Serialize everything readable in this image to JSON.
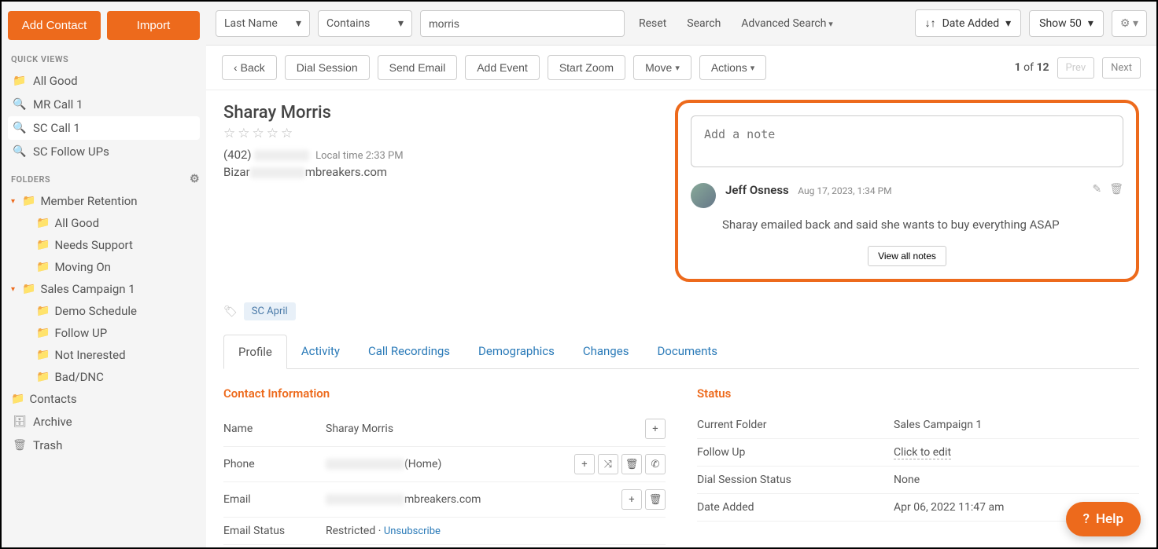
{
  "sidebar": {
    "add_contact": "Add Contact",
    "import": "Import",
    "quick_views_label": "QUICK VIEWS",
    "quick_views": [
      {
        "label": "All Good",
        "type": "folder"
      },
      {
        "label": "MR Call 1",
        "type": "search"
      },
      {
        "label": "SC Call 1",
        "type": "search",
        "active": true
      },
      {
        "label": "SC Follow UPs",
        "type": "search"
      }
    ],
    "folders_label": "FOLDERS",
    "folders": [
      {
        "label": "Member Retention",
        "children": [
          "All Good",
          "Needs Support",
          "Moving On"
        ]
      },
      {
        "label": "Sales Campaign 1",
        "children": [
          "Demo Schedule",
          "Follow UP",
          "Not Inerested",
          "Bad/DNC"
        ]
      }
    ],
    "contacts": "Contacts",
    "archive": "Archive",
    "trash": "Trash"
  },
  "toolbar": {
    "filter_field": "Last Name",
    "filter_op": "Contains",
    "search_value": "morris",
    "reset": "Reset",
    "search": "Search",
    "advanced": "Advanced Search",
    "sort": "Date Added",
    "show": "Show 50"
  },
  "actions": {
    "back": "Back",
    "dial": "Dial Session",
    "email": "Send Email",
    "event": "Add Event",
    "zoom": "Start Zoom",
    "move": "Move",
    "actions": "Actions",
    "page_current": "1",
    "page_sep": "of",
    "page_total": "12",
    "prev": "Prev",
    "next": "Next"
  },
  "contact": {
    "name": "Sharay Morris",
    "phone_prefix": "(402)",
    "local_time": "Local time 2:33 PM",
    "email_prefix": "Bizar",
    "email_suffix": "mbreakers.com",
    "tag": "SC April"
  },
  "notes": {
    "placeholder": "Add a note",
    "author": "Jeff Osness",
    "date": "Aug 17, 2023, 1:34 PM",
    "text": "Sharay emailed back and said she wants to buy everything ASAP",
    "view_all": "View all notes"
  },
  "tabs": [
    "Profile",
    "Activity",
    "Call Recordings",
    "Demographics",
    "Changes",
    "Documents"
  ],
  "profile": {
    "contact_info_title": "Contact Information",
    "status_title": "Status",
    "name_label": "Name",
    "name_value": "Sharay Morris",
    "phone_label": "Phone",
    "phone_suffix": "(Home)",
    "email_label": "Email",
    "email_suffix": "mbreakers.com",
    "email_status_label": "Email Status",
    "email_status_value": "Restricted",
    "unsubscribe": "Unsubscribe",
    "folder_label": "Current Folder",
    "folder_value": "Sales Campaign 1",
    "followup_label": "Follow Up",
    "followup_value": "Click to edit",
    "dial_label": "Dial Session Status",
    "dial_value": "None",
    "added_label": "Date Added",
    "added_value": "Apr 06, 2022 11:47 am"
  },
  "help": "Help"
}
